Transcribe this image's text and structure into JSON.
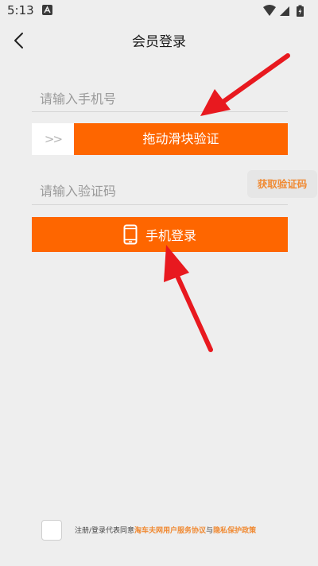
{
  "status_bar": {
    "time": "5:13",
    "app_icon": "a-letter-icon",
    "icons": [
      "wifi-icon",
      "cellular-signal-icon",
      "battery-charging-icon"
    ]
  },
  "header": {
    "back_icon": "chevron-left-icon",
    "title": "会员登录"
  },
  "form": {
    "phone_placeholder": "请输入手机号",
    "slider": {
      "handle_icon": "double-chevron-right-icon",
      "handle_glyph": ">>",
      "text": "拖动滑块验证"
    },
    "code_placeholder": "请输入验证码",
    "get_code_label": "获取验证码",
    "login": {
      "icon": "smartphone-icon",
      "label": "手机登录"
    }
  },
  "agreement": {
    "prefix": "注册/登录代表同意",
    "service_link": "淘车夫网用户服务协议",
    "conjunction": "与",
    "privacy_link": "隐私保护政策"
  },
  "annotations": {
    "arrow_color": "#e8191f"
  },
  "colors": {
    "accent": "#fe6600",
    "link": "#f08a33",
    "background": "#eeeeee"
  }
}
